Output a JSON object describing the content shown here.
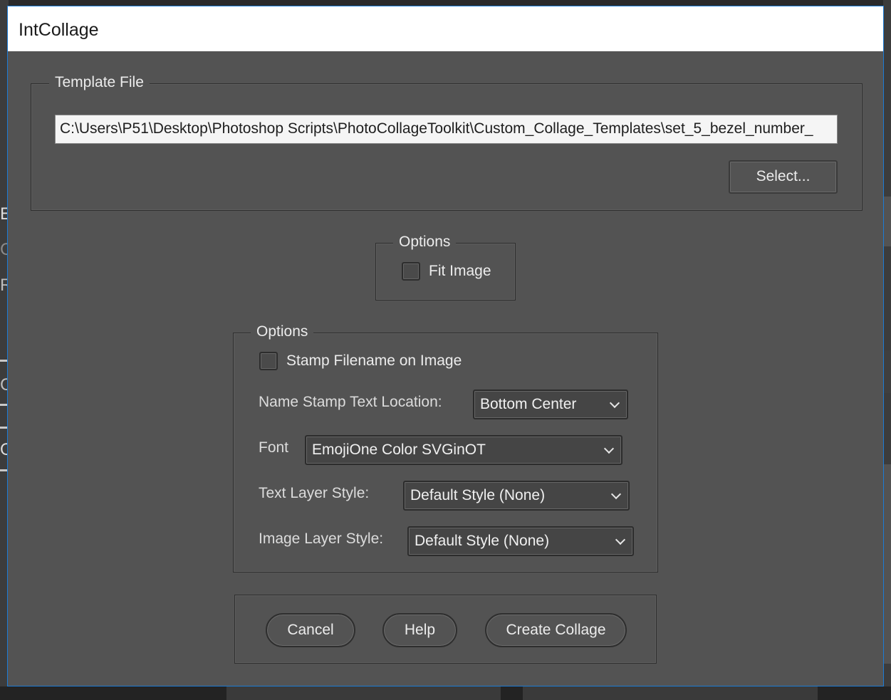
{
  "dialog": {
    "title": "IntCollage"
  },
  "template_file": {
    "group_label": "Template File",
    "path_value": "C:\\Users\\P51\\Desktop\\Photoshop Scripts\\PhotoCollageToolkit\\Custom_Collage_Templates\\set_5_bezel_number_",
    "select_label": "Select..."
  },
  "options_fit": {
    "group_label": "Options",
    "fit_image_label": "Fit Image",
    "fit_image_checked": false
  },
  "options_stamp": {
    "group_label": "Options",
    "stamp_label": "Stamp Filename on Image",
    "stamp_checked": false,
    "location_label": "Name Stamp Text  Location:",
    "location_value": "Bottom Center",
    "font_label": "Font",
    "font_value": "EmojiOne Color SVGinOT",
    "text_style_label": "Text Layer Style:",
    "text_style_value": "Default Style (None)",
    "image_style_label": "Image Layer Style:",
    "image_style_value": "Default Style (None)"
  },
  "actions": {
    "cancel_label": "Cancel",
    "help_label": "Help",
    "create_label": "Create Collage"
  },
  "colors": {
    "dialog_bg": "#535353",
    "titlebar_bg": "#ffffff",
    "accent_border": "#1c7cd6"
  }
}
